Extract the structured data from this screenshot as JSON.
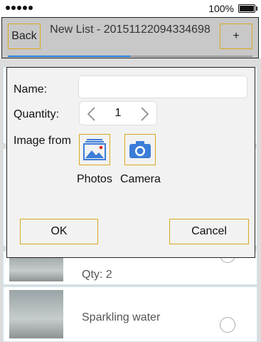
{
  "status_bar": {
    "battery_percent": "100%"
  },
  "nav": {
    "back_label": "Back",
    "title": "New List - 20151122094334698",
    "add_label": "+",
    "progress_fraction": 0.5
  },
  "list": {
    "items": [
      {
        "text": "Qty: 2"
      },
      {
        "text": "Sparkling water"
      }
    ]
  },
  "dialog": {
    "name_label": "Name:",
    "name_value": "",
    "quantity_label": "Quantity:",
    "quantity_value": "1",
    "image_from_label": "Image from",
    "photos_label": "Photos",
    "camera_label": "Camera",
    "ok_label": "OK",
    "cancel_label": "Cancel"
  },
  "colors": {
    "accent_border": "#d9a91f",
    "icon_blue": "#3b7dd8",
    "progress_blue": "#1d7fe0"
  }
}
